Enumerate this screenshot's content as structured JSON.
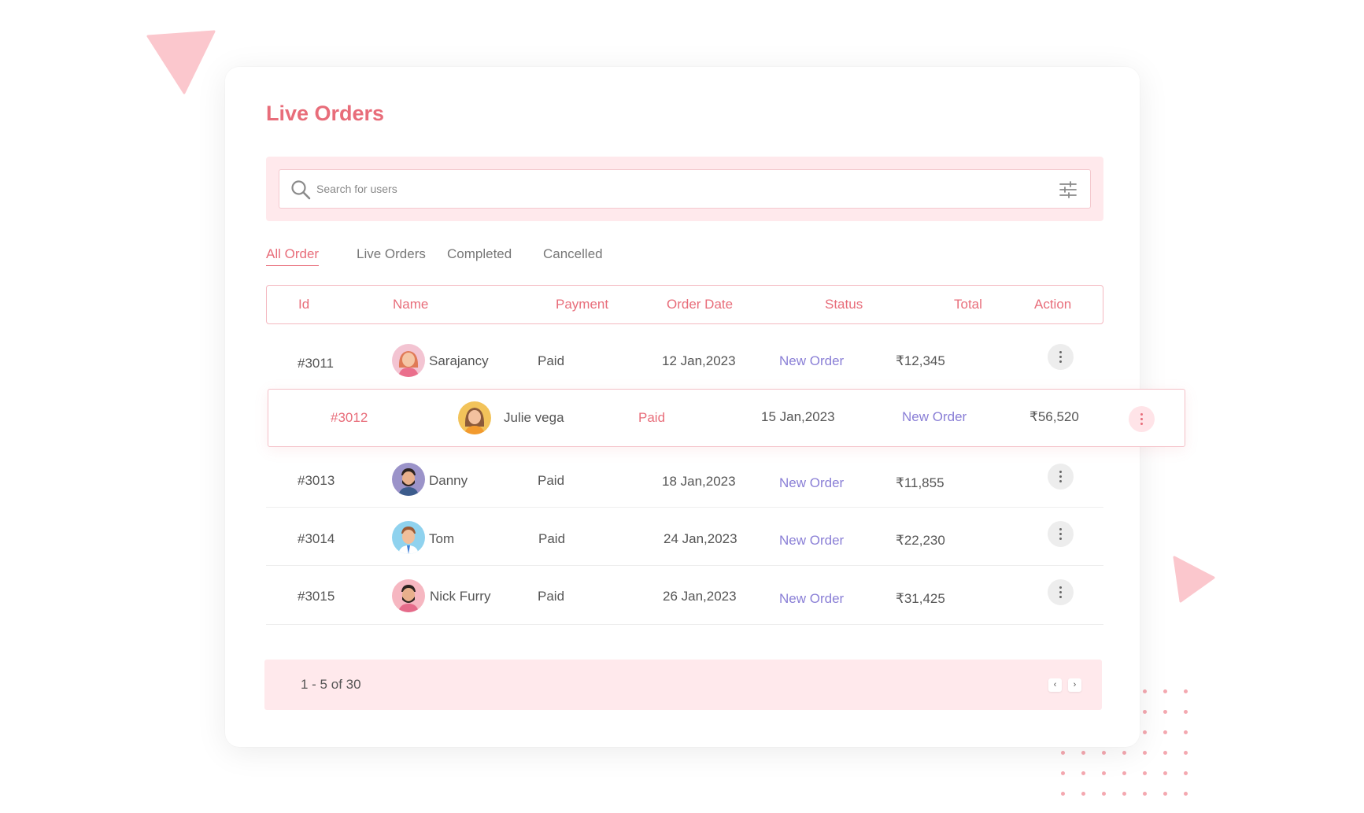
{
  "page": {
    "title": "Live Orders"
  },
  "search": {
    "placeholder": "Search for users"
  },
  "tabs": [
    {
      "label": "All Order",
      "active": true
    },
    {
      "label": "Live Orders",
      "active": false
    },
    {
      "label": "Completed",
      "active": false
    },
    {
      "label": "Cancelled",
      "active": false
    }
  ],
  "table": {
    "headers": [
      "Id",
      "Name",
      "Payment",
      "Order Date",
      "Status",
      "Total",
      "Action"
    ],
    "rows": [
      {
        "id": "#3011",
        "name": "Sarajancy",
        "payment": "Paid",
        "date": "12 Jan,2023",
        "status": "New Order",
        "total": "₹12,345",
        "avatar": "woman-redhair-avatar"
      },
      {
        "id": "#3012",
        "name": "Julie vega",
        "payment": "Paid",
        "date": "15 Jan,2023",
        "status": "New Order",
        "total": "₹56,520",
        "avatar": "woman-brownhair-avatar",
        "highlighted": true
      },
      {
        "id": "#3013",
        "name": "Danny",
        "payment": "Paid",
        "date": "18 Jan,2023",
        "status": "New Order",
        "total": "₹11,855",
        "avatar": "man-beard-avatar"
      },
      {
        "id": "#3014",
        "name": "Tom",
        "payment": "Paid",
        "date": "24 Jan,2023",
        "status": "New Order",
        "total": "₹22,230",
        "avatar": "man-blue-avatar"
      },
      {
        "id": "#3015",
        "name": "Nick Furry",
        "payment": "Paid",
        "date": "26 Jan,2023",
        "status": "New Order",
        "total": "₹31,425",
        "avatar": "man-beard-pink-avatar"
      }
    ]
  },
  "pagination": {
    "summary": "1 - 5 of 30",
    "prev": "‹",
    "next": "›"
  },
  "colors": {
    "accent": "#e86d7a",
    "status": "#8a7fd6",
    "tint": "#ffe9ec"
  }
}
